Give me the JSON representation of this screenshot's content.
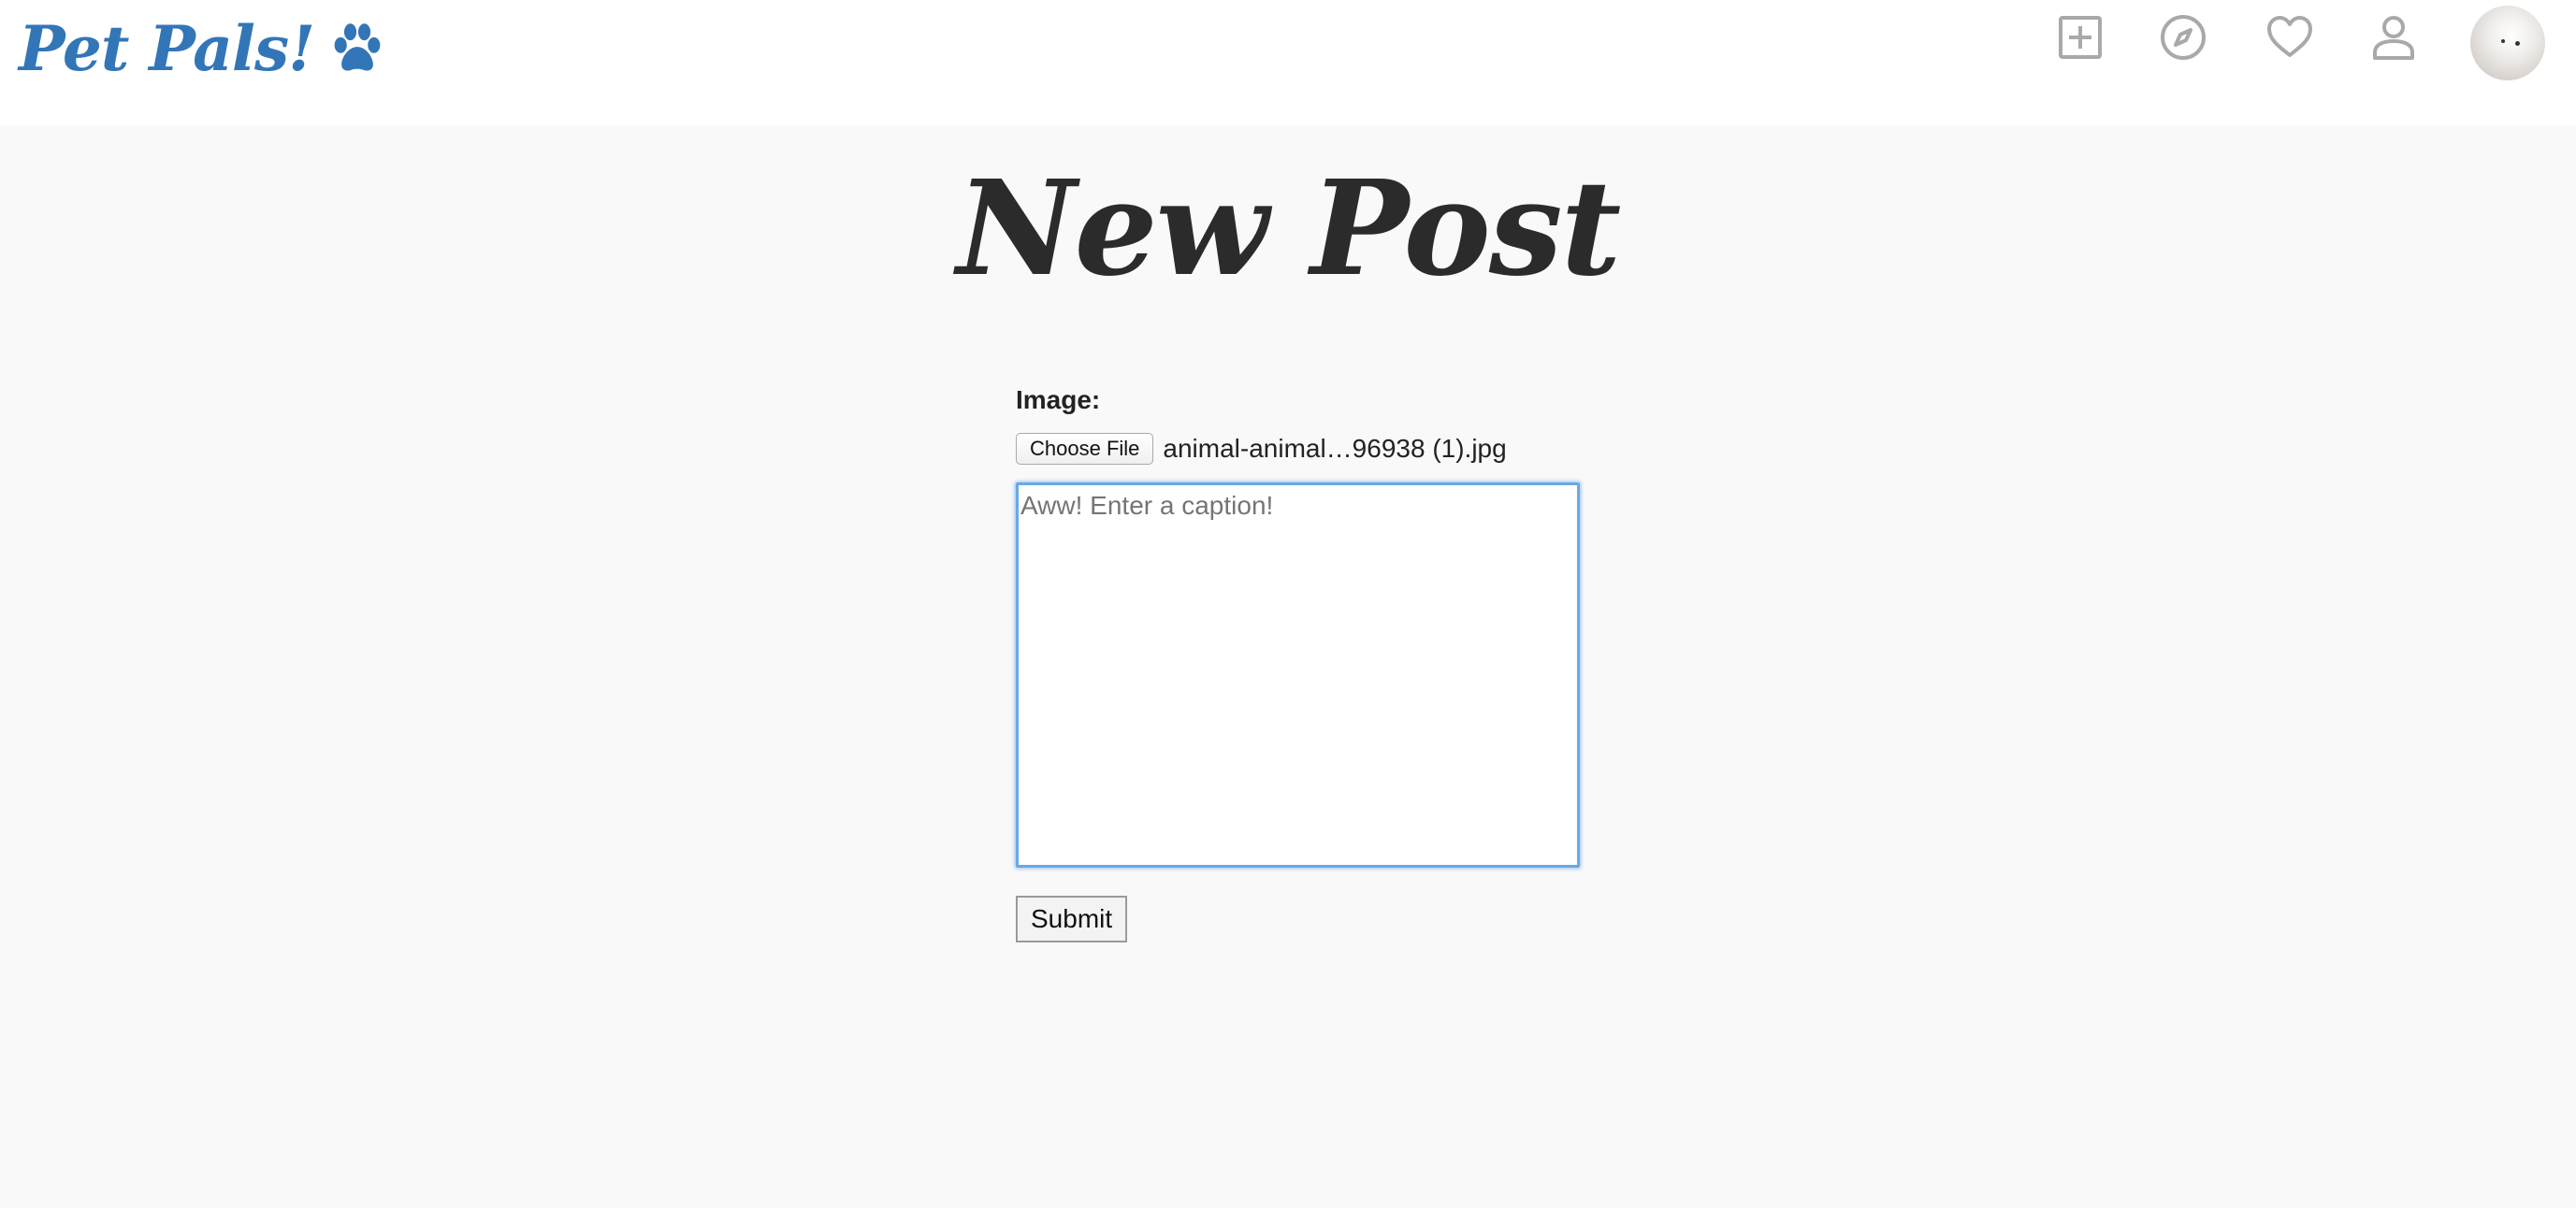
{
  "brand": {
    "name": "Pet Pals!",
    "color": "#3276b8",
    "icon": "paw-icon"
  },
  "nav": {
    "icons": [
      "plus-square-icon",
      "compass-icon",
      "heart-icon",
      "user-icon"
    ],
    "icon_color": "#a9a9a9",
    "avatar": "avatar"
  },
  "page": {
    "title": "New Post"
  },
  "form": {
    "image_label": "Image:",
    "choose_file_label": "Choose File",
    "file_name": "animal-animal…96938 (1).jpg",
    "caption_placeholder": "Aww! Enter a caption!",
    "caption_value": "",
    "submit_label": "Submit"
  }
}
